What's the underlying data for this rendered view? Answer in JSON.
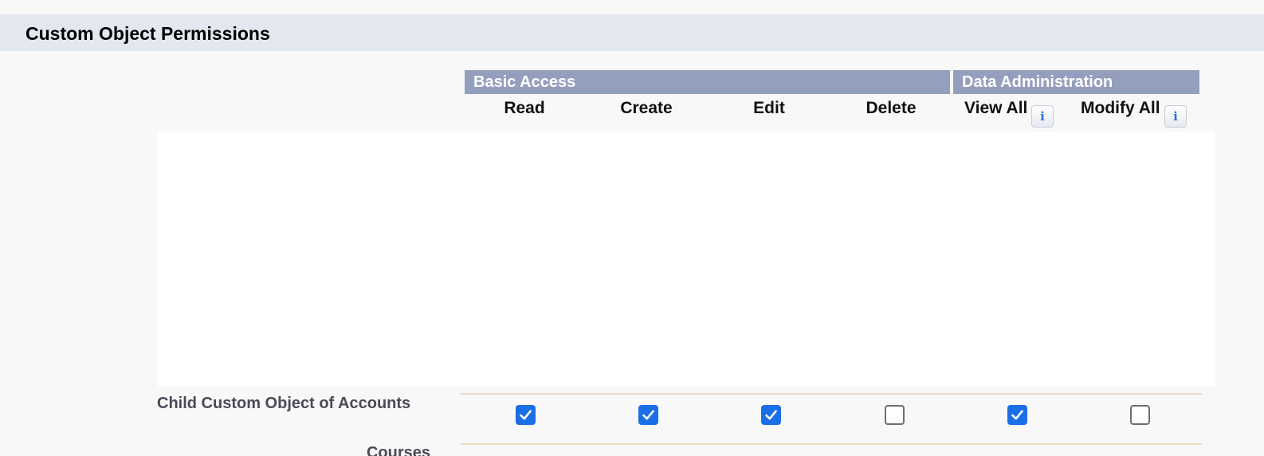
{
  "section": {
    "title": "Custom Object Permissions"
  },
  "groups": {
    "basic_access": "Basic Access",
    "data_administration": "Data Administration"
  },
  "columns": {
    "read": "Read",
    "create": "Create",
    "edit": "Edit",
    "delete": "Delete",
    "view_all": "View All",
    "modify_all": "Modify All",
    "info_glyph": "i"
  },
  "rows": [
    {
      "label": "Child Custom Object of Accounts",
      "permissions": {
        "read": true,
        "create": true,
        "edit": true,
        "delete": false,
        "view_all": true,
        "modify_all": false
      }
    },
    {
      "label": "Courses"
    }
  ],
  "colors": {
    "section_header_bg": "#e3e7ef",
    "group_header_bg": "#949fbe",
    "checkbox_checked": "#1b6fe6",
    "row_separator": "#e6dfc2"
  },
  "icons": {
    "info": "info-icon",
    "check": "checkmark-icon"
  }
}
